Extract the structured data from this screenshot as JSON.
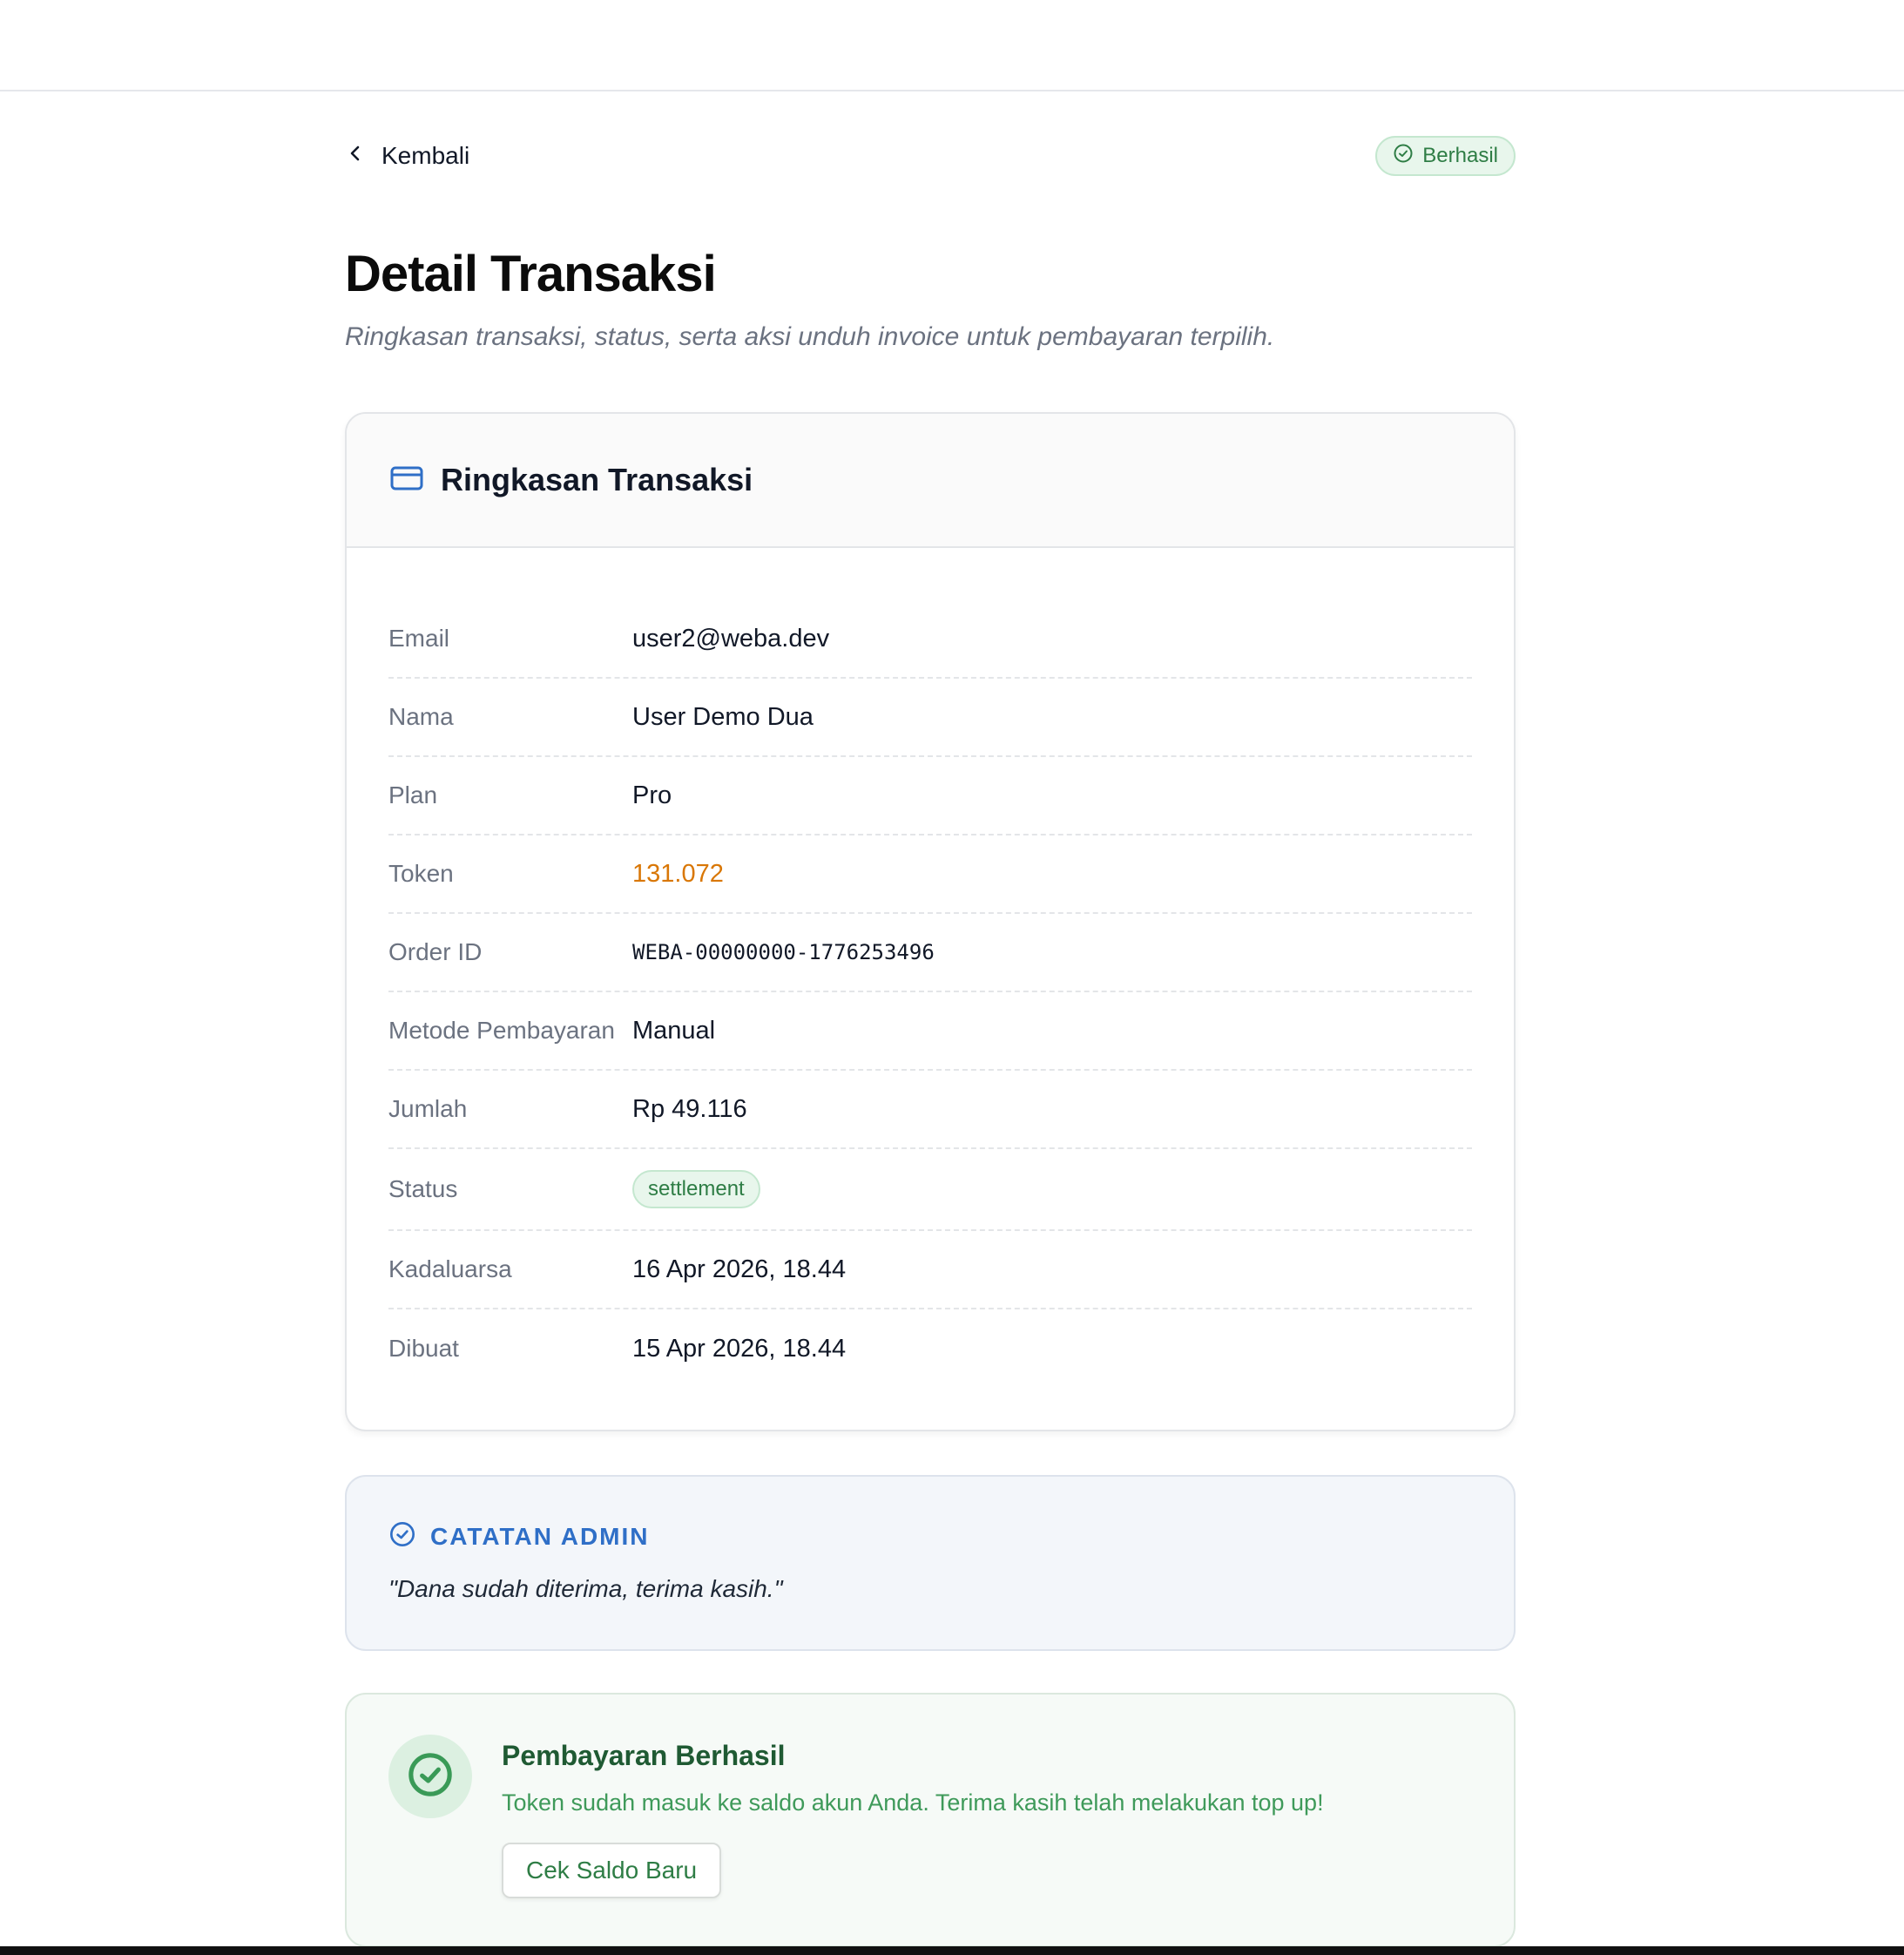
{
  "header": {
    "back_label": "Kembali",
    "status_label": "Berhasil"
  },
  "page": {
    "title": "Detail Transaksi",
    "subtitle": "Ringkasan transaksi, status, serta aksi unduh invoice untuk pembayaran terpilih."
  },
  "summary": {
    "title": "Ringkasan Transaksi",
    "rows": [
      {
        "label": "Email",
        "value": "user2@weba.dev"
      },
      {
        "label": "Nama",
        "value": "User Demo Dua"
      },
      {
        "label": "Plan",
        "value": "Pro"
      },
      {
        "label": "Token",
        "value": "131.072"
      },
      {
        "label": "Order ID",
        "value": "WEBA-00000000-1776253496"
      },
      {
        "label": "Metode Pembayaran",
        "value": "Manual"
      },
      {
        "label": "Jumlah",
        "value": "Rp 49.116"
      },
      {
        "label": "Status",
        "value": "settlement"
      },
      {
        "label": "Kadaluarsa",
        "value": "16 Apr 2026, 18.44"
      },
      {
        "label": "Dibuat",
        "value": "15 Apr 2026, 18.44"
      }
    ]
  },
  "admin_note": {
    "title": "CATATAN ADMIN",
    "text": "\"Dana sudah diterima, terima kasih.\""
  },
  "success": {
    "title": "Pembayaran Berhasil",
    "text": "Token sudah masuk ke saldo akun Anda. Terima kasih telah melakukan top up!",
    "button_label": "Cek Saldo Baru"
  },
  "colors": {
    "accent_blue": "#2f6fc7",
    "success_green": "#2e7d45",
    "token_orange": "#d97706"
  },
  "icons": {
    "back": "chevron-left-icon",
    "status": "check-circle-icon",
    "card": "credit-card-icon",
    "note": "check-circle-icon",
    "success": "check-circle-icon"
  }
}
